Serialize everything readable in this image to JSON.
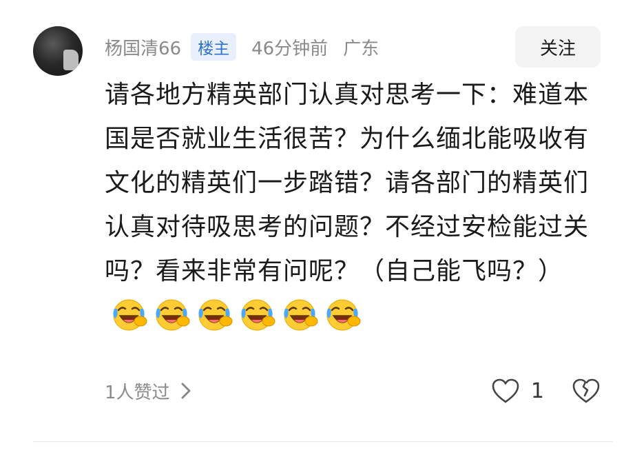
{
  "comment": {
    "username": "杨国清66",
    "badge": "楼主",
    "time": "46分钟前",
    "location": "广东",
    "follow_label": "关注",
    "text": "请各地方精英部门认真对思考一下：难道本国是否就业生活很苦？为什么缅北能吸收有文化的精英们一步踏错？请各部门的精英们认真对待吸思考的问题？不经过安检能过关吗？看来非常有问呢？（自己能飞吗？）",
    "emoji": "laughing-crying",
    "emoji_count": 6,
    "likes_summary": "1人赞过",
    "like_count": "1"
  },
  "colors": {
    "badge_bg": "#e8f0fb",
    "badge_text": "#2f6fd4",
    "meta_text": "#8a8a8a",
    "follow_bg": "#f3f3f3"
  },
  "icons": [
    "avatar",
    "laughing-crying-icon",
    "chevron-right-icon",
    "heart-icon",
    "broken-heart-icon"
  ]
}
